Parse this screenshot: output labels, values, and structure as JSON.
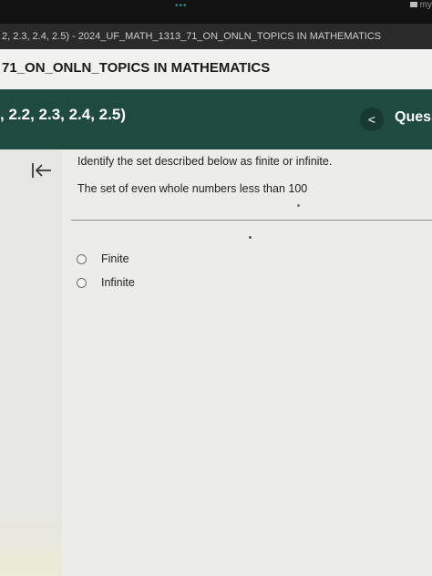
{
  "browser": {
    "tab_title": "2, 2.3, 2.4, 2.5) - 2024_UF_MATH_1313_71_ON_ONLN_TOPICS IN MATHEMATICS",
    "corner_text": "my"
  },
  "course": {
    "title": "71_ON_ONLN_TOPICS IN MATHEMATICS"
  },
  "assignment": {
    "sections": ", 2.2, 2.3, 2.4, 2.5)",
    "back_symbol": "<",
    "question_tab": "Ques"
  },
  "question": {
    "prompt": "Identify the set described below as finite or infinite.",
    "text": "The set of even whole numbers less than 100",
    "options": [
      {
        "label": "Finite",
        "selected": false
      },
      {
        "label": "Infinite",
        "selected": false
      }
    ]
  },
  "colors": {
    "header_green": "#1f4a3f",
    "background": "#ecece9"
  }
}
